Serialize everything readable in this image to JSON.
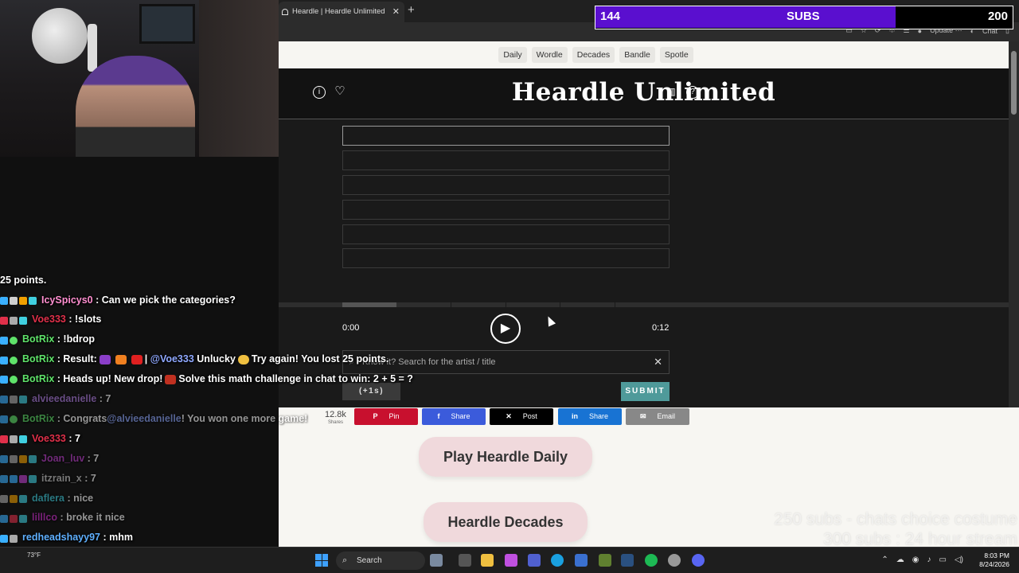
{
  "browser": {
    "tab_title": "Heardle | Heardle Unlimited",
    "tab_close": "✕",
    "new_tab": "+",
    "toolbar": {
      "update_label": "Update ⋯",
      "chat_label": "Chat"
    }
  },
  "site": {
    "nav": [
      "Daily",
      "Wordle",
      "Decades",
      "Bandle",
      "Spotle"
    ],
    "title": "Heardle Unlimited",
    "player": {
      "time_current": "0:00",
      "time_total": "0:12",
      "progress_fraction": 0.0
    },
    "search": {
      "placeholder": "Know it? Search for the artist / title",
      "clear": "✕"
    },
    "skip_label": "(+1s)",
    "submit_label": "SUBMIT"
  },
  "share": {
    "count": "12.8k",
    "count_label": "Shares",
    "buttons": [
      {
        "label": "Pin",
        "icon": "pinterest-icon",
        "color": "#c8102e"
      },
      {
        "label": "Share",
        "icon": "facebook-icon",
        "color": "#3b5bdb"
      },
      {
        "label": "Post",
        "icon": "x-icon",
        "color": "#000000"
      },
      {
        "label": "Share",
        "icon": "linkedin-icon",
        "color": "#1873d3"
      },
      {
        "label": "Email",
        "icon": "email-icon",
        "color": "#888888"
      }
    ]
  },
  "links": {
    "daily": "Play Heardle Daily",
    "decades": "Heardle Decades"
  },
  "subgoal": {
    "current": "144",
    "label": "SUBS",
    "target": "200",
    "fill_fraction": 0.72
  },
  "stream_overlay": {
    "line1": "250 subs - chats choice costume",
    "line2": "300 subs : 24 hour stream"
  },
  "chat": {
    "messages": [
      {
        "user": "",
        "text": "25 points.",
        "user_color": "#ffffff"
      },
      {
        "user": "IcySpicys0",
        "text": ": Can we pick the categories?",
        "user_color": "#ff8fd0"
      },
      {
        "user": "Voe333",
        "text": ": !slots",
        "user_color": "#e0304a"
      },
      {
        "user": "BotRix",
        "text": ": !bdrop",
        "user_color": "#5fe36a"
      },
      {
        "user": "BotRix",
        "text": ": Result:",
        "mention": "@Voe333",
        "text2": "Unlucky",
        "text3": "Try again! You lost 25 points.",
        "user_color": "#5fe36a"
      },
      {
        "user": "BotRix",
        "text": ": Heads up! New drop!",
        "text2": "Solve this math challenge in chat to win: 2 + 5 = ?",
        "user_color": "#5fe36a"
      },
      {
        "user": "alvieedanielle",
        "text": ": 7",
        "user_color": "#b27fe6"
      },
      {
        "user": "BotRix",
        "text": ": Congrats",
        "mention": "@alvieedanielle",
        "text2": "! You won one more game!",
        "user_color": "#5fe36a"
      },
      {
        "user": "Voe333",
        "text": ": 7",
        "user_color": "#e0304a"
      },
      {
        "user": "Joan_luv",
        "text": ": 7",
        "user_color": "#c040d0"
      },
      {
        "user": "itzrain_x",
        "text": ": 7",
        "user_color": "#cccccc"
      },
      {
        "user": "daflera",
        "text": ": nice",
        "user_color": "#40d0e0"
      },
      {
        "user": "lilllco",
        "text": ": broke it nice",
        "user_color": "#d030d0"
      },
      {
        "user": "redheadshayy97",
        "text": ": mhm",
        "user_color": "#5fb0ff"
      }
    ]
  },
  "taskbar": {
    "search_label": "Search",
    "weather": "73°F",
    "time": "8:03 PM",
    "date": "8/24/2026"
  },
  "colors": {
    "submit": "#4f9a9a",
    "subgoal_fill": "#5a0fcf",
    "bot_name": "#5fe36a"
  }
}
